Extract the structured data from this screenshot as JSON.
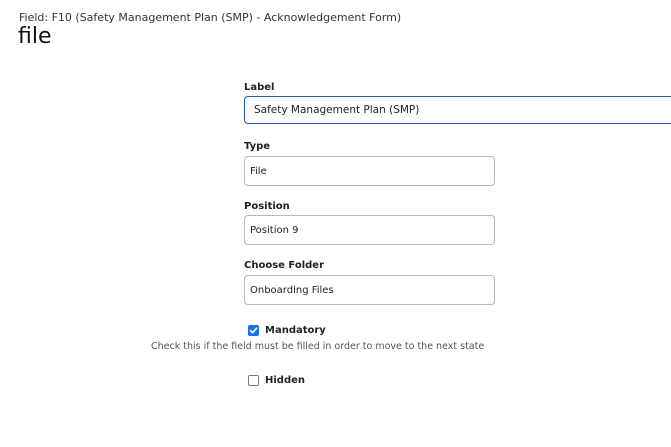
{
  "header": {
    "caption": "Field: F10 (Safety Management Plan (SMP) - Acknowledgement Form)",
    "title": "file"
  },
  "form": {
    "label": {
      "title": "Label",
      "value": "Safety Management Plan (SMP)"
    },
    "type": {
      "title": "Type",
      "value": "File"
    },
    "position": {
      "title": "Position",
      "value": "Position 9"
    },
    "folder": {
      "title": "Choose Folder",
      "value": "Onboarding Files"
    },
    "mandatory": {
      "label": "Mandatory",
      "checked": true,
      "help": "Check this if the field must be filled in order to move to the next state"
    },
    "hidden": {
      "label": "Hidden",
      "checked": false
    }
  },
  "colors": {
    "accent": "#1a73e8",
    "focus_border": "#1f5fa8"
  },
  "icons": {
    "checked": "checkmark-icon"
  }
}
